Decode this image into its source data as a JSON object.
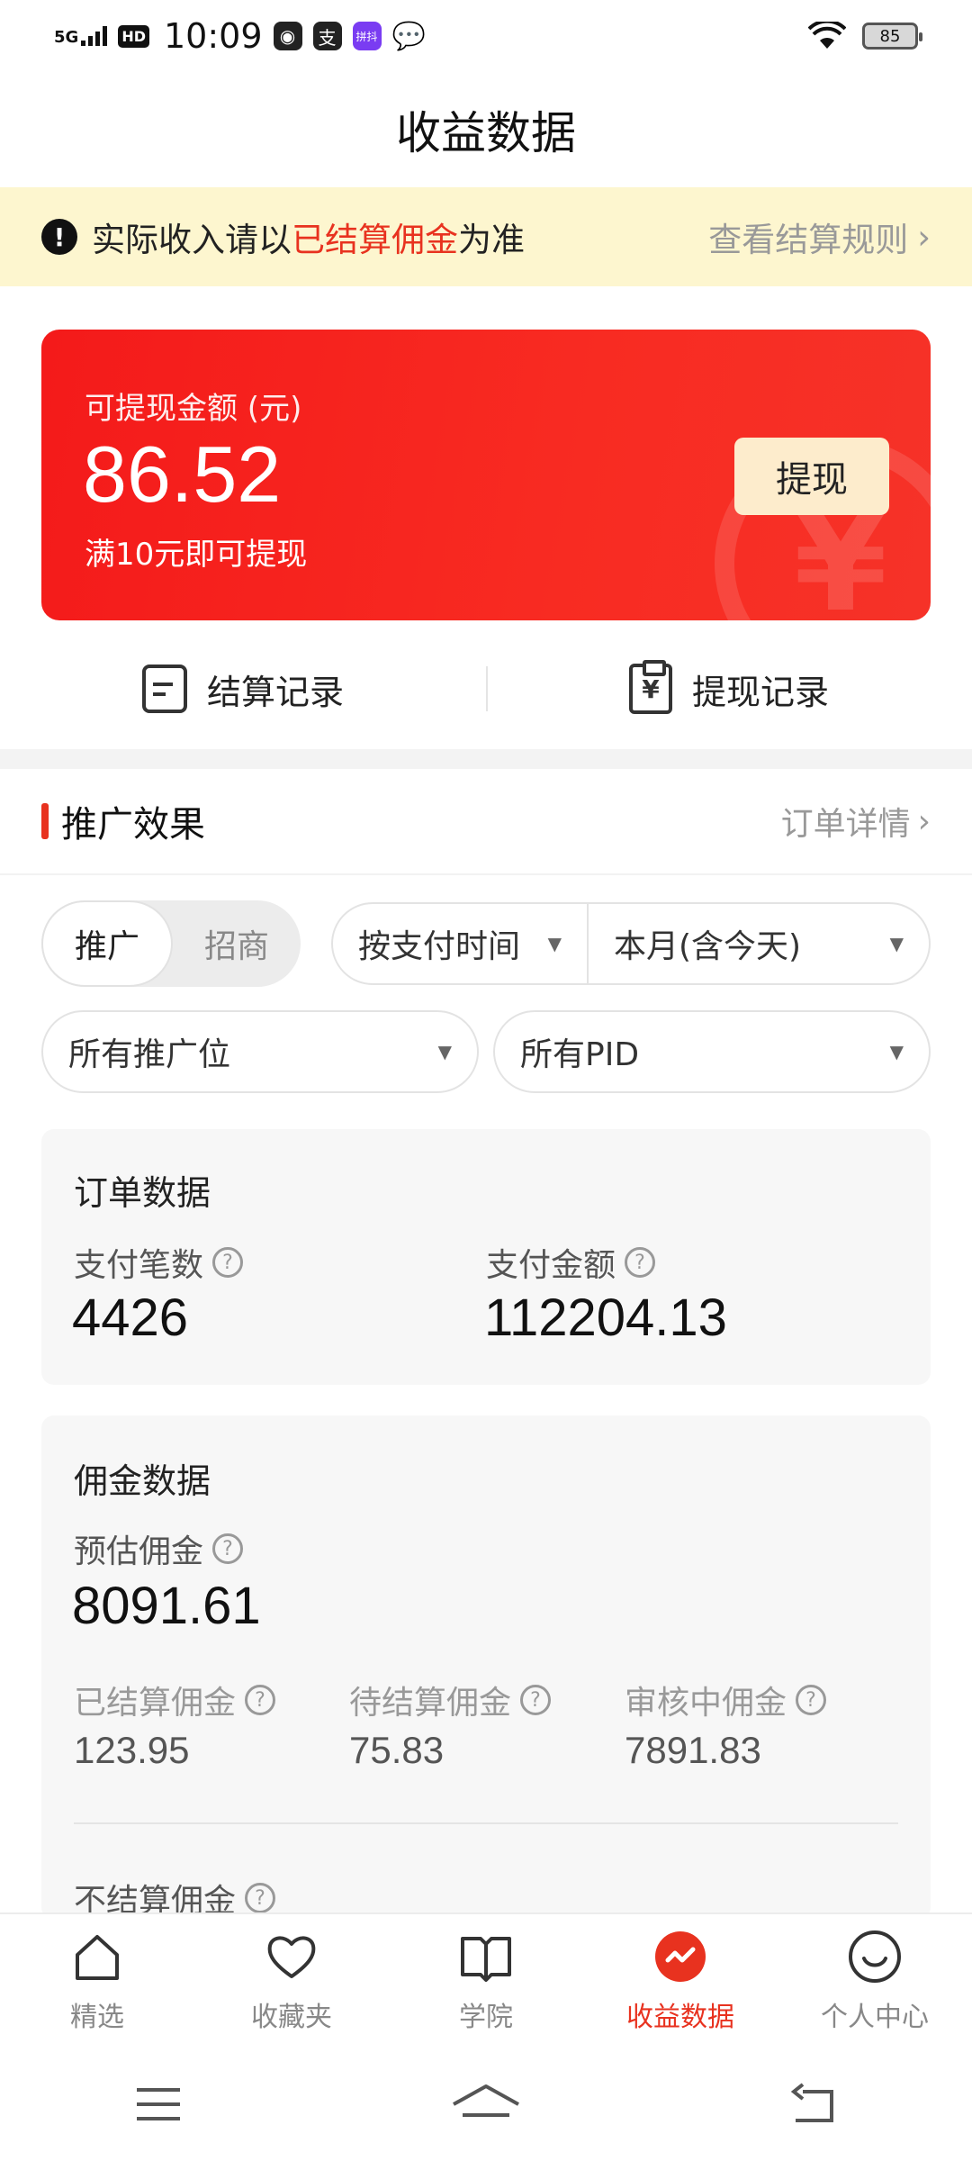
{
  "status_bar": {
    "network": "5G",
    "hd": "HD",
    "time": "10:09",
    "app1": "支",
    "app2": "拼抖",
    "battery": "85"
  },
  "page_title": "收益数据",
  "notice": {
    "prefix": "实际收入请以",
    "highlight": "已结算佣金",
    "suffix": "为准",
    "link": "查看结算规则"
  },
  "balance_card": {
    "label": "可提现金额 (元)",
    "amount": "86.52",
    "tip": "满10元即可提现",
    "withdraw_button": "提现"
  },
  "records": {
    "settlement": "结算记录",
    "withdrawal": "提现记录"
  },
  "promo_section": {
    "title": "推广效果",
    "more": "订单详情"
  },
  "filters": {
    "segment": [
      "推广",
      "招商"
    ],
    "time_type": "按支付时间",
    "period": "本月(含今天)",
    "position": "所有推广位",
    "pid": "所有PID"
  },
  "order_data": {
    "title": "订单数据",
    "count_label": "支付笔数",
    "count_value": "4426",
    "amount_label": "支付金额",
    "amount_value": "112204.13"
  },
  "commission_data": {
    "title": "佣金数据",
    "estimate_label": "预估佣金",
    "estimate_value": "8091.61",
    "settled_label": "已结算佣金",
    "settled_value": "123.95",
    "pending_label": "待结算佣金",
    "pending_value": "75.83",
    "review_label": "审核中佣金",
    "review_value": "7891.83",
    "unsettled_label": "不结算佣金"
  },
  "tabs": [
    "精选",
    "收藏夹",
    "学院",
    "收益数据",
    "个人中心"
  ],
  "colors": {
    "accent": "#e8321f",
    "notice_bg": "#fdf6cf",
    "card_red": "#f41a1a"
  }
}
